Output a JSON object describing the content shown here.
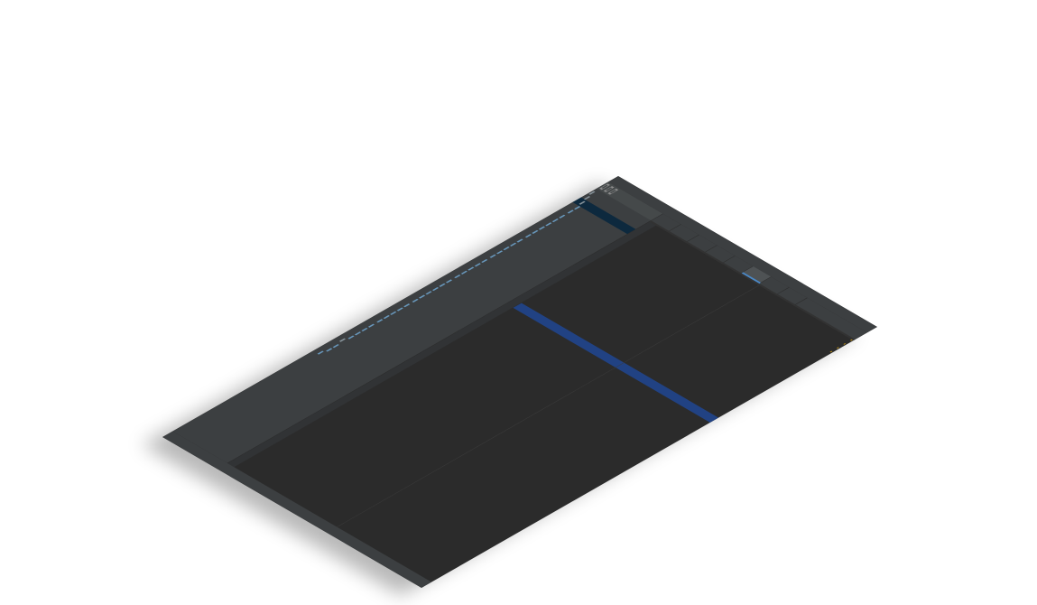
{
  "window": {
    "title": ""
  },
  "project_panel": {
    "tree": [
      {
        "label": "",
        "depth": 0,
        "kind": "folder"
      },
      {
        "label": "",
        "depth": 1,
        "kind": "folder"
      },
      {
        "label": "",
        "depth": 2,
        "kind": "folder",
        "selected": true
      },
      {
        "label": "",
        "depth": 3,
        "kind": "file"
      },
      {
        "label": "",
        "depth": 3,
        "kind": "file"
      },
      {
        "label": "",
        "depth": 3,
        "kind": "file"
      },
      {
        "label": "",
        "depth": 3,
        "kind": "file"
      },
      {
        "label": "",
        "depth": 3,
        "kind": "file"
      },
      {
        "label": "",
        "depth": 3,
        "kind": "file"
      },
      {
        "label": "",
        "depth": 3,
        "kind": "file"
      },
      {
        "label": "",
        "depth": 3,
        "kind": "file"
      },
      {
        "label": "",
        "depth": 3,
        "kind": "file"
      },
      {
        "label": "",
        "depth": 3,
        "kind": "file"
      },
      {
        "label": "",
        "depth": 3,
        "kind": "file"
      },
      {
        "label": "",
        "depth": 3,
        "kind": "file"
      },
      {
        "label": "",
        "depth": 3,
        "kind": "file"
      },
      {
        "label": "",
        "depth": 3,
        "kind": "file"
      },
      {
        "label": "",
        "depth": 3,
        "kind": "file"
      },
      {
        "label": "",
        "depth": 3,
        "kind": "file"
      },
      {
        "label": "",
        "depth": 3,
        "kind": "file"
      },
      {
        "label": "",
        "depth": 3,
        "kind": "file"
      },
      {
        "label": "",
        "depth": 3,
        "kind": "file"
      },
      {
        "label": "",
        "depth": 3,
        "kind": "file"
      },
      {
        "label": "",
        "depth": 3,
        "kind": "file"
      },
      {
        "label": "",
        "depth": 3,
        "kind": "file"
      },
      {
        "label": "",
        "depth": 3,
        "kind": "file"
      },
      {
        "label": "",
        "depth": 3,
        "kind": "file"
      },
      {
        "label": "",
        "depth": 3,
        "kind": "file"
      },
      {
        "label": "",
        "depth": 3,
        "kind": "file"
      },
      {
        "label": "",
        "depth": 3,
        "kind": "file"
      },
      {
        "label": "",
        "depth": 3,
        "kind": "file"
      },
      {
        "label": "",
        "depth": 3,
        "kind": "file"
      },
      {
        "label": "",
        "depth": 3,
        "kind": "file"
      },
      {
        "label": "",
        "depth": 3,
        "kind": "file"
      },
      {
        "label": "",
        "depth": 3,
        "kind": "file"
      },
      {
        "label": "",
        "depth": 3,
        "kind": "file"
      },
      {
        "label": "",
        "depth": 2,
        "kind": "folder"
      },
      {
        "label": "",
        "depth": 3,
        "kind": "file"
      },
      {
        "label": "",
        "depth": 3,
        "kind": "file"
      },
      {
        "label": "",
        "depth": 2,
        "kind": "file"
      }
    ]
  },
  "editor": {
    "tabs": [
      {
        "label": "",
        "active": false
      },
      {
        "label": "",
        "active": false
      },
      {
        "label": "",
        "active": false
      },
      {
        "label": "",
        "active": false
      },
      {
        "label": "",
        "active": false
      },
      {
        "label": "",
        "active": true
      },
      {
        "label": "",
        "active": false
      },
      {
        "label": "",
        "active": false
      }
    ],
    "highlighted_line_index": 16
  },
  "status_bar": {
    "items": [
      "",
      "",
      ""
    ]
  },
  "colors": {
    "background": "#2b2b2b",
    "panel": "#3c3f41",
    "selection": "#214283",
    "tag": "#e8bf6a",
    "string": "#6a8759",
    "comment": "#808080"
  }
}
